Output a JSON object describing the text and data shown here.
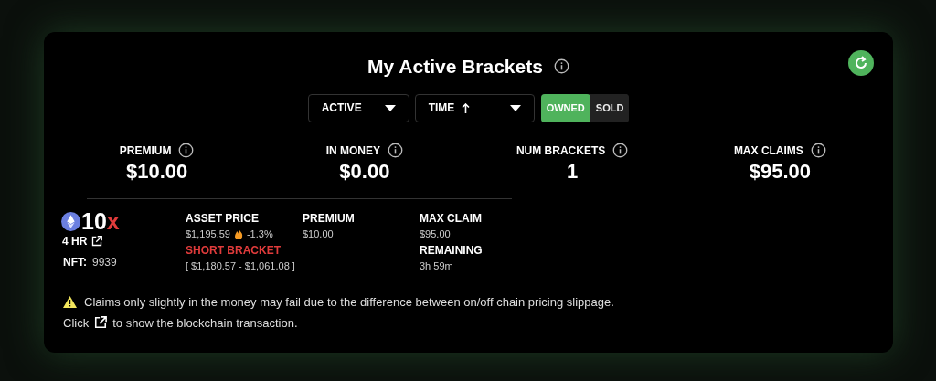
{
  "title": "My Active Brackets",
  "filters": {
    "status": {
      "value": "ACTIVE"
    },
    "sort": {
      "value": "TIME"
    },
    "toggle": [
      {
        "label": "OWNED",
        "selected": true
      },
      {
        "label": "SOLD",
        "selected": false
      }
    ]
  },
  "stats": [
    {
      "label": "PREMIUM",
      "value": "$10.00"
    },
    {
      "label": "IN MONEY",
      "value": "$0.00"
    },
    {
      "label": "NUM BRACKETS",
      "value": "1"
    },
    {
      "label": "MAX CLAIMS",
      "value": "$95.00"
    }
  ],
  "brackets": [
    {
      "leverage_number": "10",
      "leverage_unit": "x",
      "duration": "4 HR",
      "nft_label": "NFT:",
      "nft": "9939",
      "asset_price_label": "ASSET PRICE",
      "asset_price": "$1,195.59",
      "change": "-1.3%",
      "side": "SHORT BRACKET",
      "range": "[ $1,180.57 - $1,061.08 ]",
      "premium_label": "PREMIUM",
      "premium": "$10.00",
      "max_claim_label": "MAX CLAIM",
      "max_claim": "$95.00",
      "remaining_label": "REMAINING",
      "remaining": "3h 59m"
    }
  ],
  "notice": {
    "warning": "Claims only slightly in the money may fail due to the difference between on/off chain pricing slippage.",
    "click": "Click",
    "rest": "to show the blockchain transaction."
  }
}
